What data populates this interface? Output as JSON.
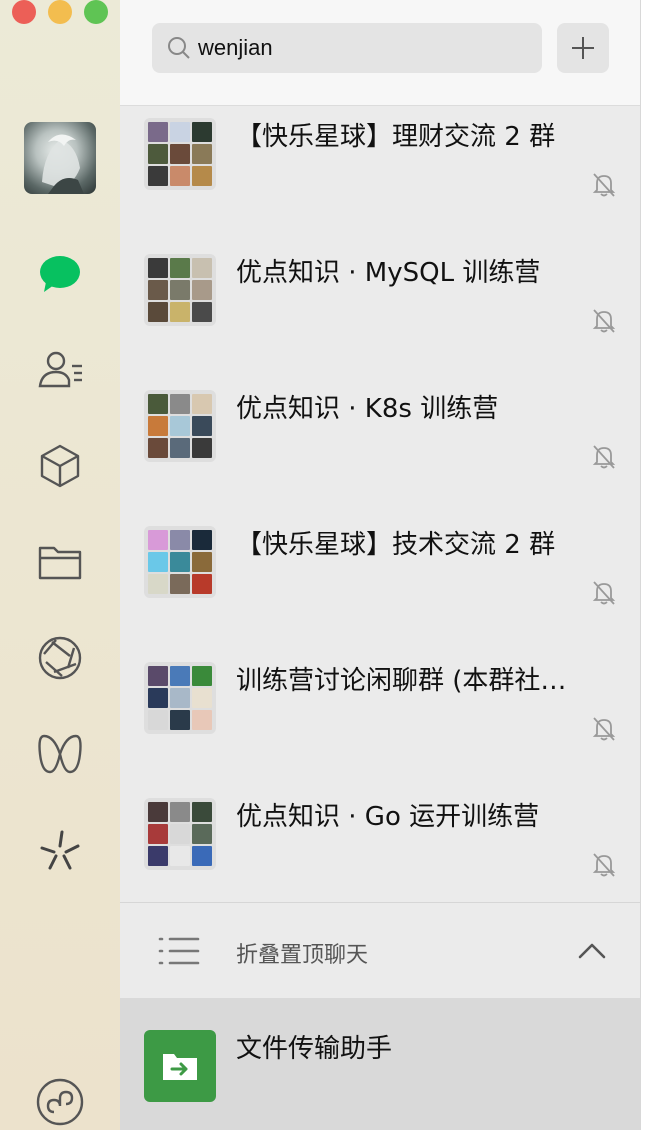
{
  "search": {
    "value": "wenjian"
  },
  "chats": [
    {
      "name": "【快乐星球】理财交流 2 群",
      "muted": true
    },
    {
      "name": "优点知识 · MySQL 训练营",
      "muted": true
    },
    {
      "name": "优点知识 · K8s 训练营",
      "muted": true
    },
    {
      "name": "【快乐星球】技术交流 2 群",
      "muted": true
    },
    {
      "name": "训练营讨论闲聊群 (本群社…",
      "muted": true
    },
    {
      "name": "优点知识 · Go 运开训练营",
      "muted": true
    }
  ],
  "folded": {
    "label": "折叠置顶聊天"
  },
  "file_transfer": {
    "name": "文件传输助手"
  },
  "sidebar": {
    "icons": [
      "chat-icon",
      "contacts-icon",
      "box-icon",
      "folder-icon",
      "moments-icon",
      "channels-icon",
      "discover-icon",
      "mini-program-icon"
    ]
  },
  "colors": {
    "accent": "#07c160",
    "file_transfer_bg": "#3d9a45",
    "sidebar_bg": "#ece7d3"
  }
}
